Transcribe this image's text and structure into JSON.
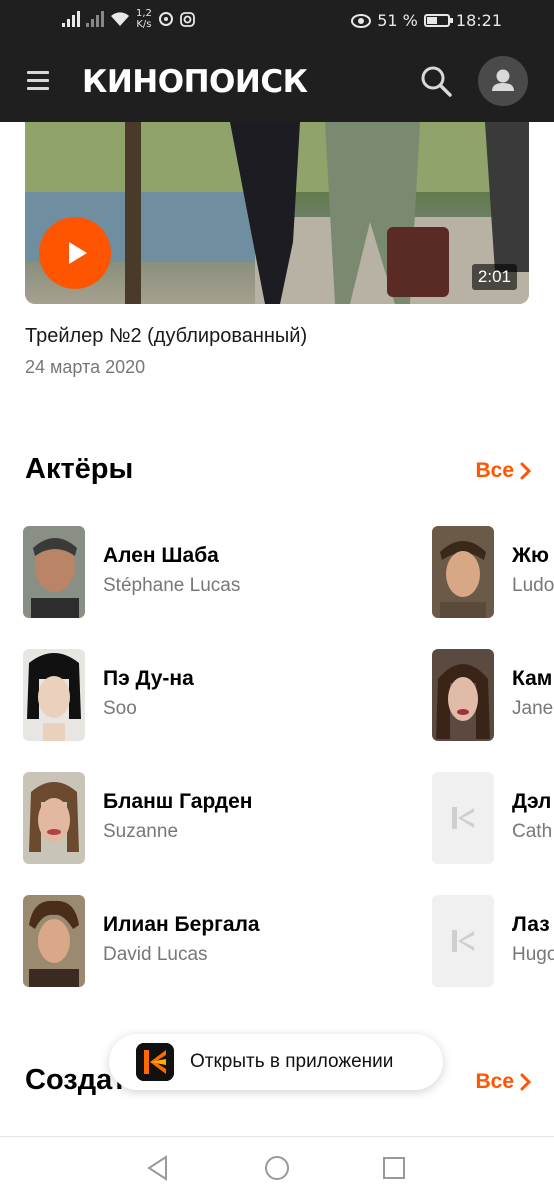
{
  "status_bar": {
    "speed_value": "1,2",
    "speed_unit": "K/s",
    "battery_percent": "51 %",
    "battery_level": 0.51,
    "time": "18:21"
  },
  "header": {
    "logo_text": "КИНОПОИСК",
    "icons": [
      "menu-icon",
      "search-icon",
      "profile-icon"
    ]
  },
  "trailer": {
    "duration": "2:01",
    "title": "Трейлер №2 (дублированный)",
    "date": "24 марта 2020"
  },
  "actors_section": {
    "title": "Актёры",
    "see_all": "Все",
    "left_column": [
      {
        "name": "Ален Шаба",
        "role": "Stéphane Lucas"
      },
      {
        "name": "Пэ Ду-на",
        "role": "Soo"
      },
      {
        "name": "Бланш Гарден",
        "role": "Suzanne"
      },
      {
        "name": "Илиан Бергала",
        "role": "David Lucas"
      }
    ],
    "right_column": [
      {
        "name": "Жю",
        "role": "Ludo"
      },
      {
        "name": "Кам",
        "role": "Jane"
      },
      {
        "name": "Дэл",
        "role": "Cath"
      },
      {
        "name": "Лаз",
        "role": "Hugo"
      }
    ]
  },
  "creators_section": {
    "title": "Создатели",
    "see_all": "Все"
  },
  "open_app_banner": {
    "label": "Открыть в приложении"
  },
  "colors": {
    "accent": "#ff5500",
    "header_bg": "#1f1f1f"
  }
}
